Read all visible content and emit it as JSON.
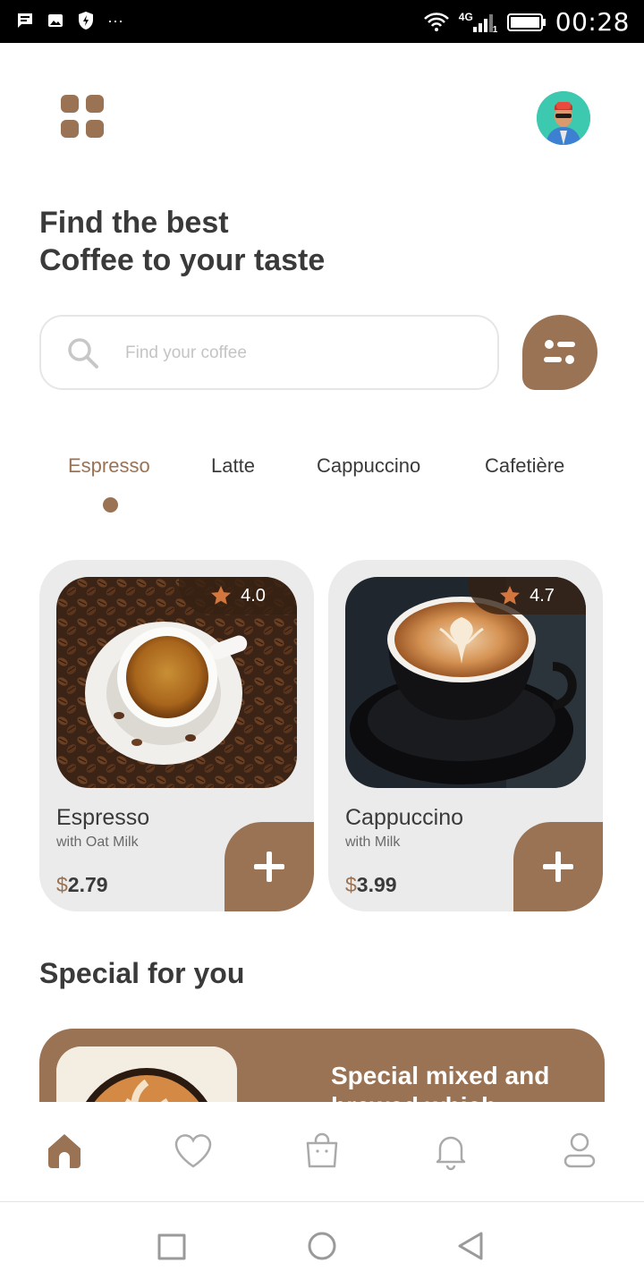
{
  "status_bar": {
    "network": "4G",
    "sim": "1",
    "time": "00:28",
    "more": "···"
  },
  "header": {
    "title_line1": "Find the best",
    "title_line2": "Coffee to your taste"
  },
  "search": {
    "placeholder": "Find your coffee"
  },
  "tabs": [
    {
      "label": "Espresso",
      "active": true
    },
    {
      "label": "Latte",
      "active": false
    },
    {
      "label": "Cappuccino",
      "active": false
    },
    {
      "label": "Cafetière",
      "active": false
    }
  ],
  "products": [
    {
      "name": "Espresso",
      "subtitle": "with Oat Milk",
      "currency": "$",
      "price": "2.79",
      "rating": "4.0"
    },
    {
      "name": "Cappuccino",
      "subtitle": "with Milk",
      "currency": "$",
      "price": "3.99",
      "rating": "4.7"
    }
  ],
  "special": {
    "section_title": "Special for you",
    "card_text": "Special mixed and brewed which"
  },
  "colors": {
    "accent": "#9a7254",
    "text": "#3a3a3a",
    "card_bg": "#ebebeb"
  }
}
